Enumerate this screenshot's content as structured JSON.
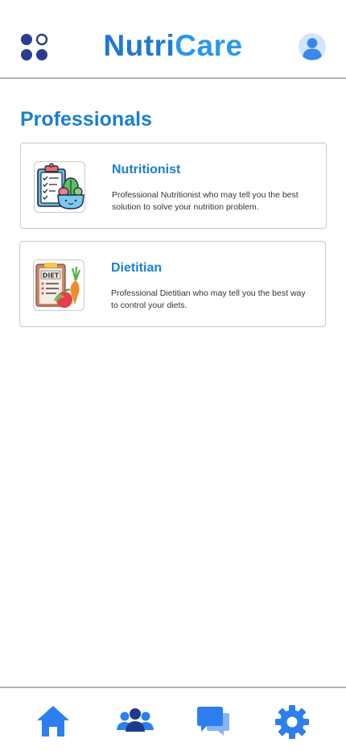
{
  "app": {
    "brand_part1": "Nutri",
    "brand_part2": "Care"
  },
  "header": {
    "menu_icon": "grid-menu-icon",
    "profile_icon": "user-avatar-icon"
  },
  "section": {
    "title": "Professionals"
  },
  "professionals": [
    {
      "title": "Nutritionist",
      "description": "Professional Nutritionist who may tell you the best solution to solve your nutrition problem.",
      "icon": "nutrition-clipboard-icon"
    },
    {
      "title": "Dietitian",
      "description": "Professional Dietitian who may tell you the best way to control your diets.",
      "icon": "diet-clipboard-icon"
    }
  ],
  "bottom_nav": {
    "items": [
      "home-icon",
      "users-icon",
      "chat-icon",
      "settings-icon"
    ]
  },
  "colors": {
    "primary": "#1b7fd1",
    "brand_dark": "#1f78d6",
    "brand_light": "#2a98ea",
    "navy": "#2b3d8f",
    "nav_blue": "#2d7ff0"
  }
}
